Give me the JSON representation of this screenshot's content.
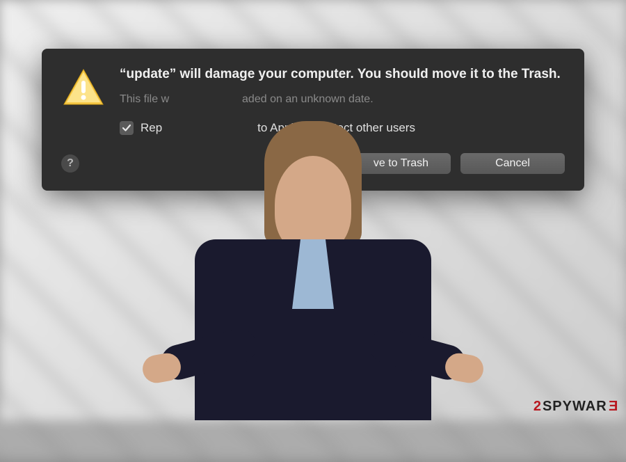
{
  "background": {
    "description": "blurred-keyboard"
  },
  "dialog": {
    "icon": "warning-triangle-icon",
    "title": "“update” will damage your computer. You should move it to the Trash.",
    "subtitle_visible_left": "This file w",
    "subtitle_visible_right": "aded on an unknown date.",
    "checkbox": {
      "checked": true,
      "label_visible_left": "Rep",
      "label_visible_right": "to Apple to protect other users"
    },
    "buttons": {
      "primary_visible": "ve to Trash",
      "secondary": "Cancel"
    },
    "help": "?"
  },
  "watermark": {
    "prefix": "2",
    "main": "SPYWAR",
    "suffix": "E"
  }
}
